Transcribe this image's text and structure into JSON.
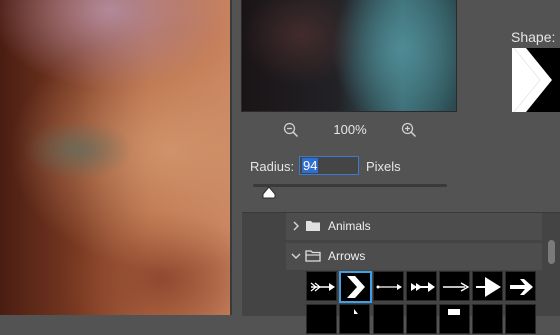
{
  "preview": {
    "zoom_level": "100%",
    "zoom_out_icon": "zoom-out-icon",
    "zoom_in_icon": "zoom-in-icon"
  },
  "radius": {
    "label": "Radius:",
    "value": "94",
    "unit": "Pixels",
    "slider_level": 0.08
  },
  "shape": {
    "label": "Shape:"
  },
  "shape_library": {
    "folders": [
      {
        "name": "Animals",
        "expanded": false
      },
      {
        "name": "Arrows",
        "expanded": true
      }
    ],
    "arrow_shapes": [
      "feathered-arrow",
      "chevron-arrow",
      "thin-arrow",
      "double-tail-arrow",
      "line-arrow",
      "triangle-arrow",
      "bold-arrow"
    ],
    "selected_index": 1
  },
  "colors": {
    "panel_bg": "#535353",
    "selection_blue": "#3fa0e8",
    "input_focus": "#3b7ad0"
  }
}
